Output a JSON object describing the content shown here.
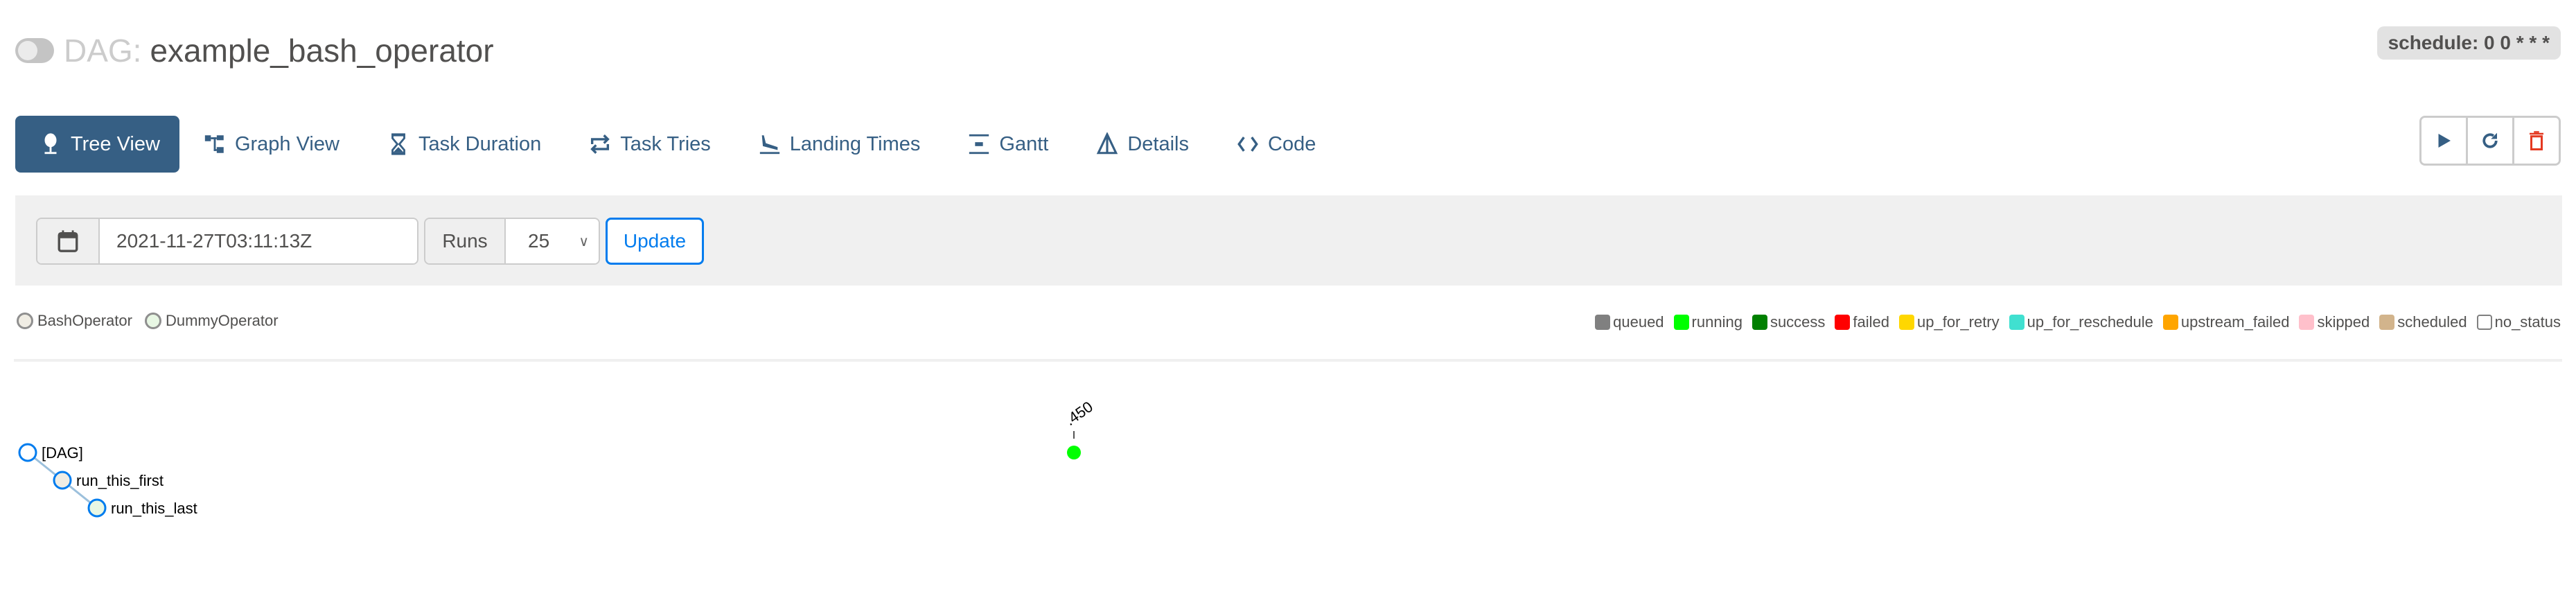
{
  "header": {
    "dag_prefix": "DAG:",
    "dag_name": "example_bash_operator",
    "paused": true,
    "schedule": "schedule: 0 0 * * *"
  },
  "nav": {
    "items": [
      {
        "label": "Tree View",
        "icon": "tree-icon",
        "active": true
      },
      {
        "label": "Graph View",
        "icon": "graph-icon",
        "active": false
      },
      {
        "label": "Task Duration",
        "icon": "hourglass-icon",
        "active": false
      },
      {
        "label": "Task Tries",
        "icon": "repeat-icon",
        "active": false
      },
      {
        "label": "Landing Times",
        "icon": "plane-landing-icon",
        "active": false
      },
      {
        "label": "Gantt",
        "icon": "gantt-icon",
        "active": false
      },
      {
        "label": "Details",
        "icon": "details-icon",
        "active": false
      },
      {
        "label": "Code",
        "icon": "code-icon",
        "active": false
      }
    ]
  },
  "actions": [
    {
      "name": "trigger-dag",
      "icon": "play-icon",
      "color": "#365f84"
    },
    {
      "name": "refresh",
      "icon": "refresh-icon",
      "color": "#365f84"
    },
    {
      "name": "delete-dag",
      "icon": "trash-icon",
      "color": "#e43921"
    }
  ],
  "filters": {
    "base_date": "2021-11-27T03:11:13Z",
    "runs_label": "Runs",
    "runs_value": "25",
    "update_label": "Update"
  },
  "operator_legend": [
    {
      "label": "BashOperator",
      "color": "#f0ede4"
    },
    {
      "label": "DummyOperator",
      "color": "#e8f7e4"
    }
  ],
  "state_legend": [
    {
      "label": "queued",
      "color": "#808080"
    },
    {
      "label": "running",
      "color": "#00ff00"
    },
    {
      "label": "success",
      "color": "#008000"
    },
    {
      "label": "failed",
      "color": "#ff0000"
    },
    {
      "label": "up_for_retry",
      "color": "#ffd700"
    },
    {
      "label": "up_for_reschedule",
      "color": "#40e0d0"
    },
    {
      "label": "upstream_failed",
      "color": "#ffa500"
    },
    {
      "label": "skipped",
      "color": "#ffc0cb"
    },
    {
      "label": "scheduled",
      "color": "#d2b48c"
    },
    {
      "label": "no_status",
      "color": "#ffffff"
    }
  ],
  "tree": {
    "nodes": [
      {
        "label": "[DAG]",
        "depth": 0,
        "fill": "#ffffff"
      },
      {
        "label": "run_this_first",
        "depth": 1,
        "fill": "#f0ede4"
      },
      {
        "label": "run_this_last",
        "depth": 2,
        "fill": "#e8f7e4"
      }
    ],
    "node_stroke": "#017cee",
    "run_label": ".450",
    "run_state": "running",
    "run_color": "#00ff00"
  }
}
